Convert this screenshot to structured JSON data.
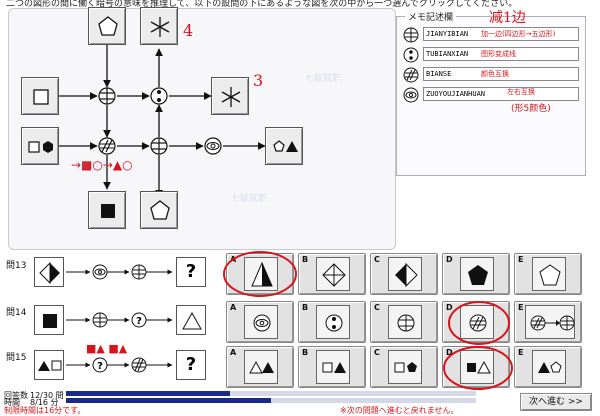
{
  "header": {
    "instruction": "二つの図形の間に働く暗号の意味を推理して、以下の設問の下にあるような図を次の中から一つ選んでクリックしてください。"
  },
  "watermark": {
    "text": "七联就职"
  },
  "memo": {
    "title": "メモ記述欄",
    "rows": [
      {
        "icon": "strikethrough-equals-icon",
        "input_value": "JIANYIBIAN",
        "note": "加一边(四边形→五边形)"
      },
      {
        "icon": "two-dots-icon",
        "input_value": "TUBIANXIAN",
        "note": "图形变成线"
      },
      {
        "icon": "double-slash-icon",
        "input_value": "BIANSE",
        "note": "颜色互换"
      },
      {
        "icon": "eye-lens-icon",
        "input_value": "ZUOYOUJIANHUAN",
        "note": "左右互换"
      }
    ],
    "annotation_top": "减1边",
    "annotation_lr": "(形5颜色)"
  },
  "diagram": {
    "numbers": [
      "4",
      "3"
    ],
    "hand_note": "→■○→▲○"
  },
  "questions": [
    {
      "label": "問13",
      "options": [
        {
          "letter": "A",
          "shape": "triangle-half-black"
        },
        {
          "letter": "B",
          "shape": "diamond-cross"
        },
        {
          "letter": "C",
          "shape": "diamond-half-black"
        },
        {
          "letter": "D",
          "shape": "black-pentagon"
        },
        {
          "letter": "E",
          "shape": "white-pentagon"
        }
      ],
      "question_mark": "?"
    },
    {
      "label": "問14",
      "options": [
        {
          "letter": "A",
          "shape": "eye-lens"
        },
        {
          "letter": "B",
          "shape": "two-dots"
        },
        {
          "letter": "C",
          "shape": "strike-equals"
        },
        {
          "letter": "D",
          "shape": "double-slash"
        },
        {
          "letter": "E",
          "shape": "double-slash-then-strike"
        }
      ],
      "question_mark": "?"
    },
    {
      "label": "問15",
      "options": [
        {
          "letter": "A",
          "shape": "tri-outline-and-black"
        },
        {
          "letter": "B",
          "shape": "square-outline-and-black-tri"
        },
        {
          "letter": "C",
          "shape": "square-outline-and-black-pent"
        },
        {
          "letter": "D",
          "shape": "black-square-outline-tri"
        },
        {
          "letter": "E",
          "shape": "black-tri-outline-pent"
        }
      ],
      "question_mark": "?",
      "hand_note": "■▲  ■▲"
    }
  ],
  "footer": {
    "progress_label": "回答数",
    "progress_value": "12/30 問",
    "time_label": "時間",
    "time_value": "8/16 分",
    "remaining": "制限時間は16分です。",
    "warning": "※次の問題へ進むと戻れません。",
    "next_button": "次へ進む >>",
    "progress_fraction": 0.4,
    "time_fraction": 0.5
  }
}
